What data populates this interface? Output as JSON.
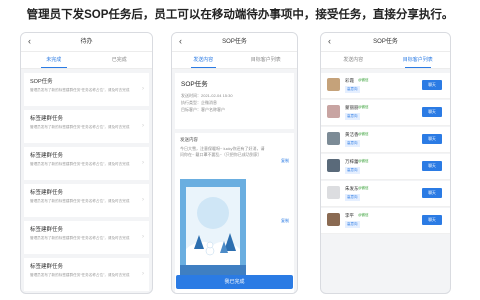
{
  "caption": "管理员下发SOP任务后，员工可以在移动端待办事项中，接受任务，直接分享执行。",
  "phone1": {
    "nav_title": "待办",
    "back_icon": "chevron-left-icon",
    "tabs": [
      "未完成",
      "已完成"
    ],
    "cards": [
      {
        "title": "SOP任务",
        "desc": "管理员发布了新的标签建群任务“任务名称占位”，请及时去完成"
      },
      {
        "title": "标签建群任务",
        "desc": "管理员发布了新的标签建群任务“任务名称占位”，请及时去完成"
      },
      {
        "title": "标签建群任务",
        "desc": "管理员发布了新的标签建群任务“任务名称占位”，请及时去完成"
      },
      {
        "title": "标签建群任务",
        "desc": "管理员发布了新的标签建群任务“任务名称占位”，请及时去完成"
      },
      {
        "title": "标签建群任务",
        "desc": "管理员发布了新的标签建群任务“任务名称占位”，请及时去完成"
      },
      {
        "title": "标签建群任务",
        "desc": "管理员发布了新的标签建群任务“任务名称占位”，请及时去完成"
      }
    ]
  },
  "phone2": {
    "nav_title": "SOP任务",
    "tabs": [
      "发送内容",
      "目标客户列表"
    ],
    "info_title": "SOP任务",
    "rows": [
      "发送时间：2021-02-04 15:30",
      "执行类型：企微消息",
      "目标客户：客户名称客户"
    ],
    "content_label": "发送内容",
    "content_text": "今日大雪，注意保暖呀~ lucky你还有了好消，请问你在~ 戴口罩不要乱~（只把你已成功到家）",
    "copy1": "复制",
    "copy2": "复制",
    "exec_button": "我已完成"
  },
  "phone3": {
    "nav_title": "SOP任务",
    "tabs": [
      "发送内容",
      "目标客户列表"
    ],
    "users": [
      {
        "name": "彩霞",
        "wx": "@微信",
        "tag": "高意向",
        "color": "#c5a27a"
      },
      {
        "name": "蒙丽丽",
        "wx": "@微信",
        "tag": "高意向",
        "color": "#c8a4a2"
      },
      {
        "name": "黄洁香",
        "wx": "@微信",
        "tag": "高意向",
        "color": "#7c8b96"
      },
      {
        "name": "万梓蕾",
        "wx": "@微信",
        "tag": "高意向",
        "color": "#5a6a7a"
      },
      {
        "name": "朱发东",
        "wx": "@微信",
        "tag": "高意向",
        "color": "#dcdde0"
      },
      {
        "name": "李平",
        "wx": "@微信",
        "tag": "高意向",
        "color": "#8a6a52"
      }
    ],
    "chat_label": "聊天"
  }
}
